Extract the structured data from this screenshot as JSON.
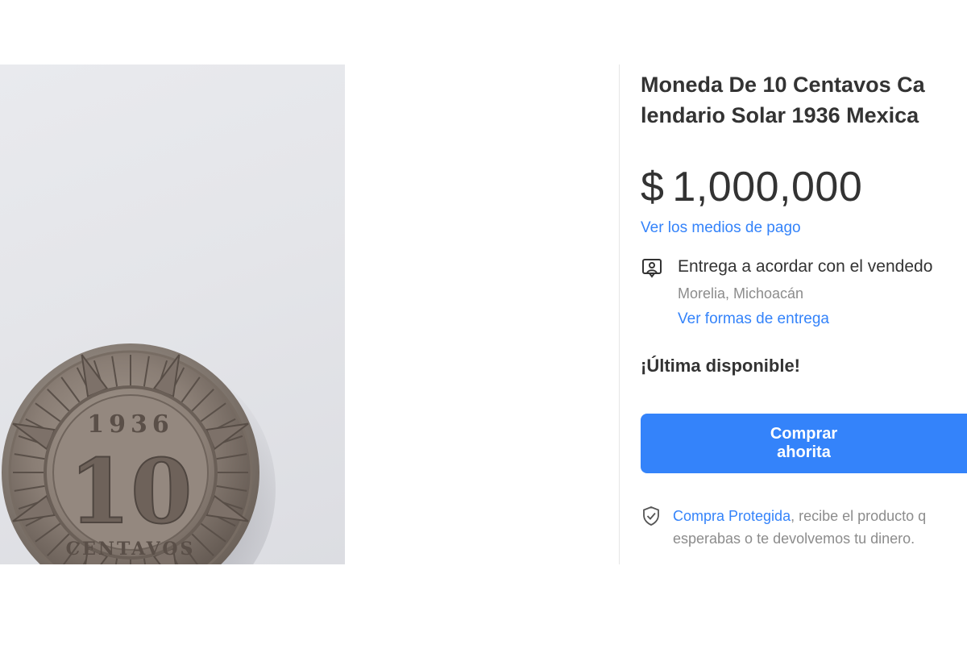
{
  "product": {
    "title_line1": "Moneda De 10 Centavos Ca",
    "title_line2": "lendario Solar 1936 Mexica",
    "price_symbol": "$",
    "price_amount": "1,000,000",
    "payment_link": "Ver los medios de pago"
  },
  "delivery": {
    "icon": "delivery-person-icon",
    "text": "Entrega a acordar con el vendedo",
    "location": "Morelia, Michoacán",
    "link": "Ver formas de entrega"
  },
  "stock": {
    "label": "¡Última disponible!"
  },
  "buy_button": {
    "label": "Comprar ahorita",
    "color": "#3483fa"
  },
  "protection": {
    "icon": "shield-check-icon",
    "link": "Compra Protegida",
    "text_line1_rest": ", recibe el producto q",
    "text_line2": "esperabas o te devolvemos tu dinero."
  },
  "coin_image": {
    "year": "1936",
    "value": "10",
    "word": "CENTAVOS"
  },
  "colors": {
    "accent": "#3483fa",
    "text": "#333333",
    "muted": "#8c8c8c"
  }
}
